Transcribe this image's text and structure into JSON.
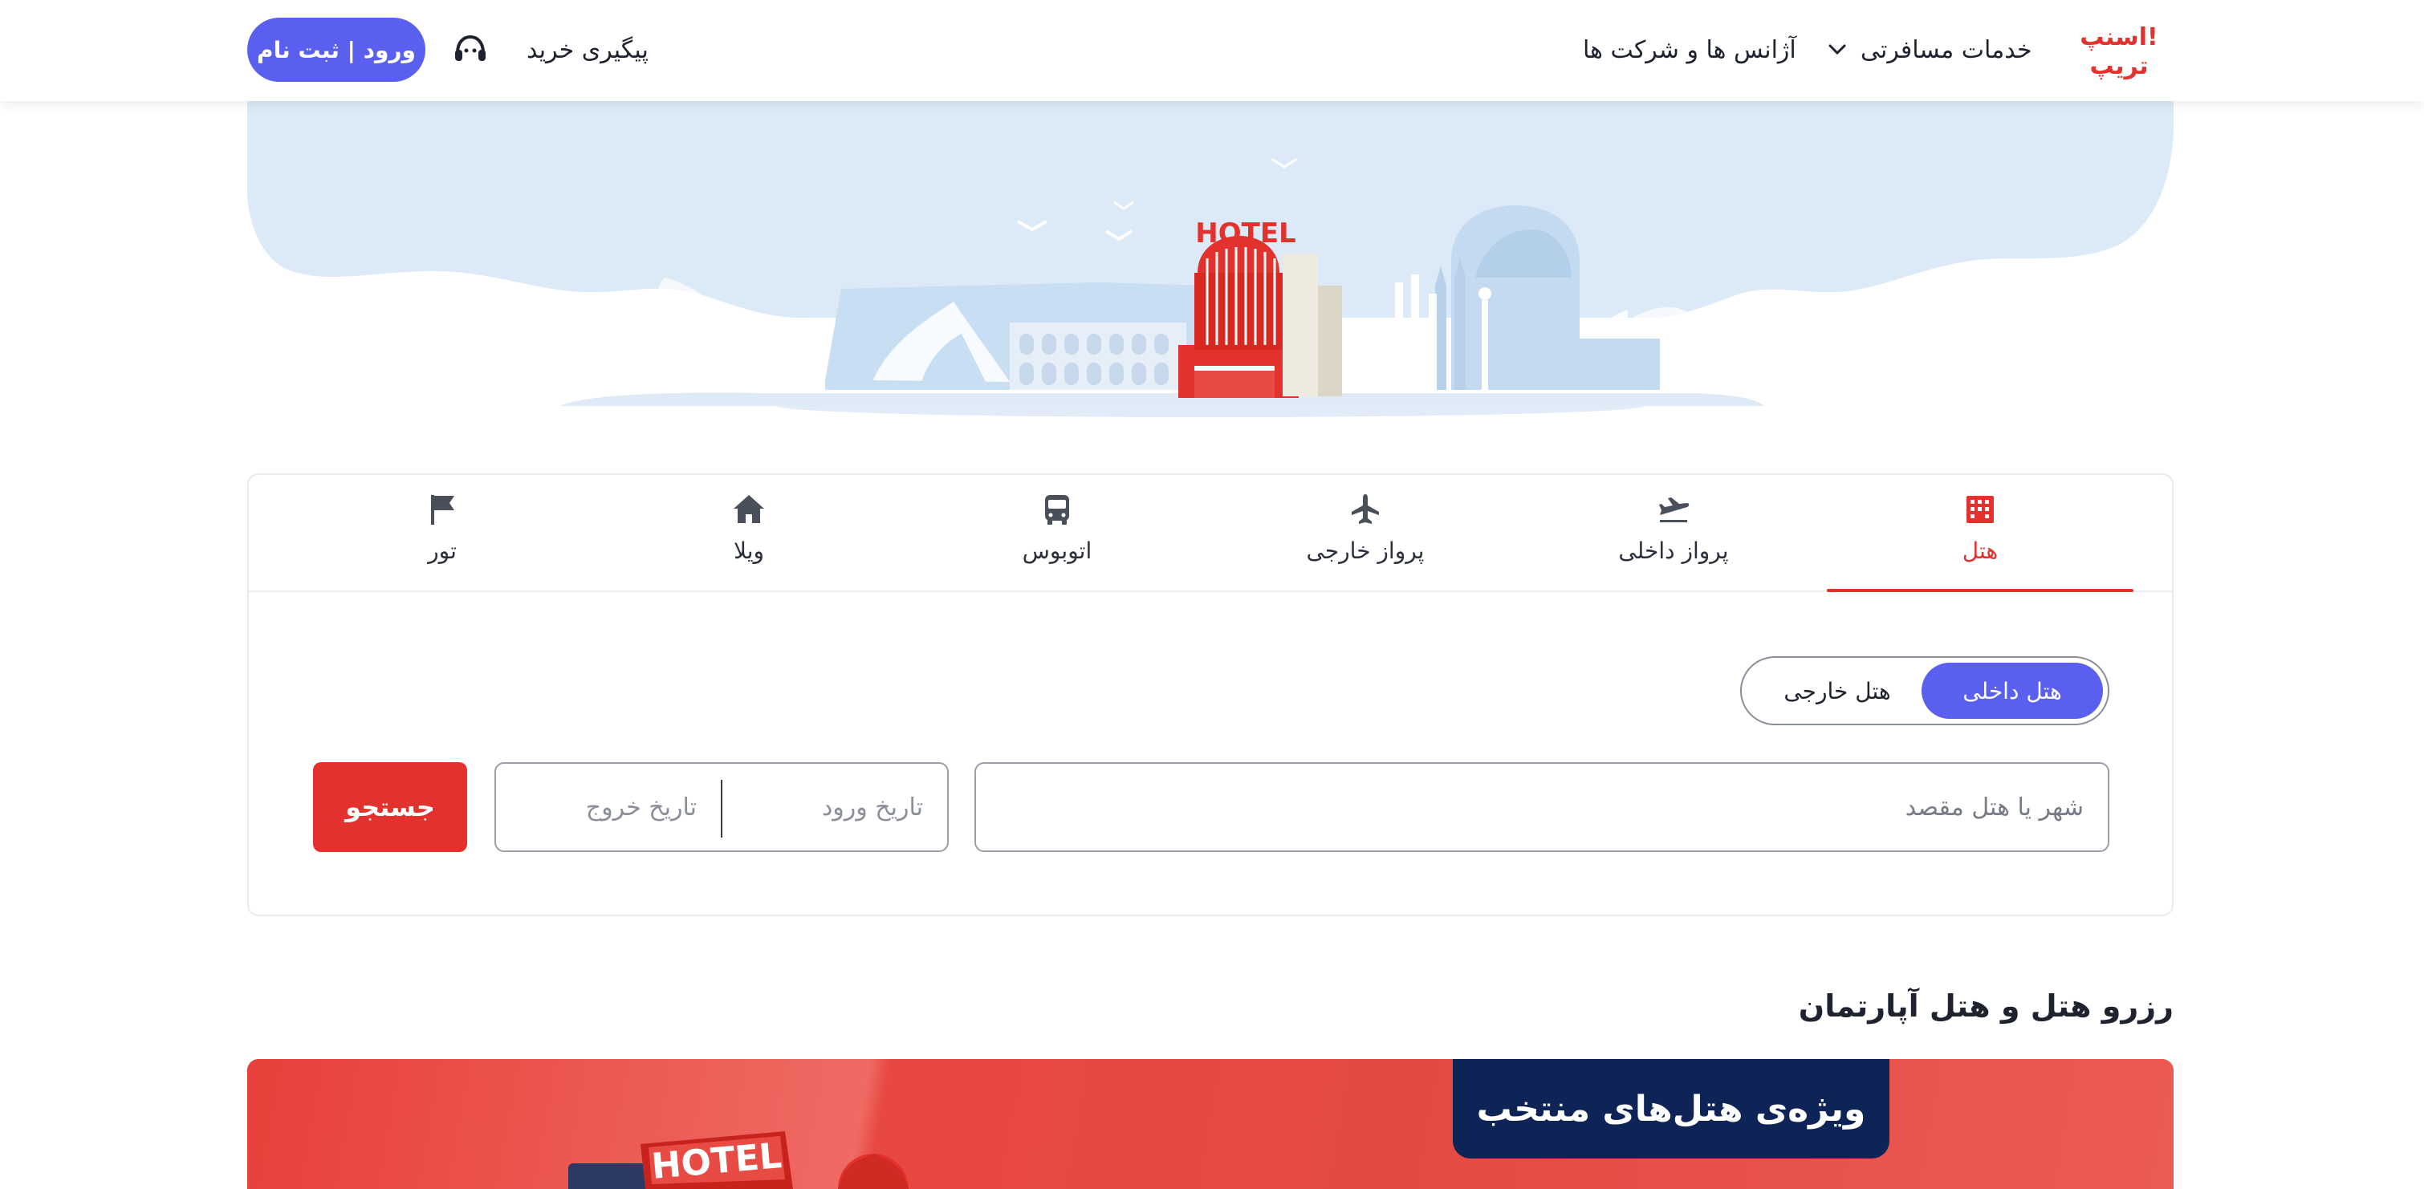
{
  "brand": {
    "logo_text": "اسنپ! تریپ",
    "color": "#e3312d"
  },
  "header": {
    "services_label": "خدمات مسافرتی",
    "agencies_label": "آژانس ها و شرکت ها",
    "track_label": "پیگیری خرید",
    "login_label": "ورود | ثبت نام",
    "accent": "#5a5ff0"
  },
  "hero": {
    "sign_text": "HOTEL"
  },
  "tabs": [
    {
      "label": "هتل",
      "icon": "hotel-building-icon",
      "active": true
    },
    {
      "label": "پرواز داخلی",
      "icon": "plane-departure-icon",
      "active": false
    },
    {
      "label": "پرواز خارجی",
      "icon": "airplane-icon",
      "active": false
    },
    {
      "label": "اتوبوس",
      "icon": "bus-icon",
      "active": false
    },
    {
      "label": "ویلا",
      "icon": "house-icon",
      "active": false
    },
    {
      "label": "تور",
      "icon": "flag-icon",
      "active": false
    }
  ],
  "search": {
    "toggle_domestic": "هتل داخلی",
    "toggle_foreign": "هتل خارجی",
    "destination_placeholder": "شهر یا هتل مقصد",
    "checkin_placeholder": "تاریخ ورود",
    "checkout_placeholder": "تاریخ خروج",
    "search_label": "جستجو",
    "search_color": "#e3312d"
  },
  "section": {
    "title": "رزرو هتل و هتل آپارتمان",
    "banner_label": "ویژه‌ی هتل‌های منتخب",
    "banner_sign": "HOTEL"
  }
}
